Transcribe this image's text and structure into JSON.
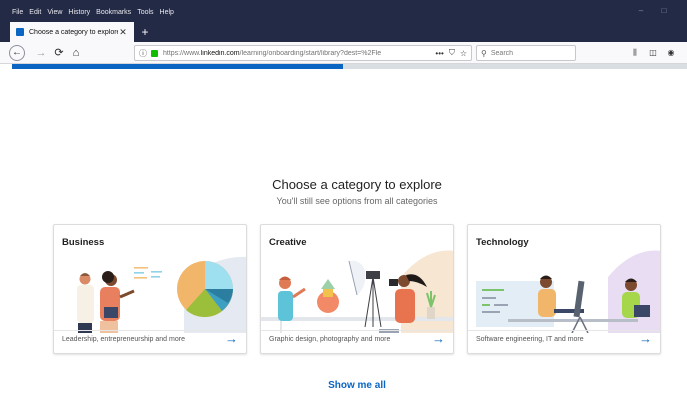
{
  "menu": {
    "items": [
      "File",
      "Edit",
      "View",
      "History",
      "Bookmarks",
      "Tools",
      "Help"
    ]
  },
  "tab": {
    "title": "Choose a category to explore",
    "close": "✕",
    "new": "+"
  },
  "nav": {
    "back": "←",
    "forward": "→",
    "reload": "⟳",
    "home": "⌂"
  },
  "urlbar": {
    "prefix": "https://www.",
    "domain": "linkedin.com",
    "path": "/learning/onboarding/start/library?dest=%2Fle",
    "more": "•••"
  },
  "search": {
    "placeholder": "Search"
  },
  "progress": {
    "percent": 49
  },
  "page": {
    "heading": "Choose a category to explore",
    "subheading": "You'll still see options from all categories",
    "show_all": "Show me all"
  },
  "cards": [
    {
      "title": "Business",
      "description": "Leadership, entrepreneurship and more"
    },
    {
      "title": "Creative",
      "description": "Graphic design, photography and more"
    },
    {
      "title": "Technology",
      "description": "Software engineering, IT and more"
    }
  ],
  "colors": {
    "accent": "#0a66c2",
    "titlebar": "#232a45"
  }
}
